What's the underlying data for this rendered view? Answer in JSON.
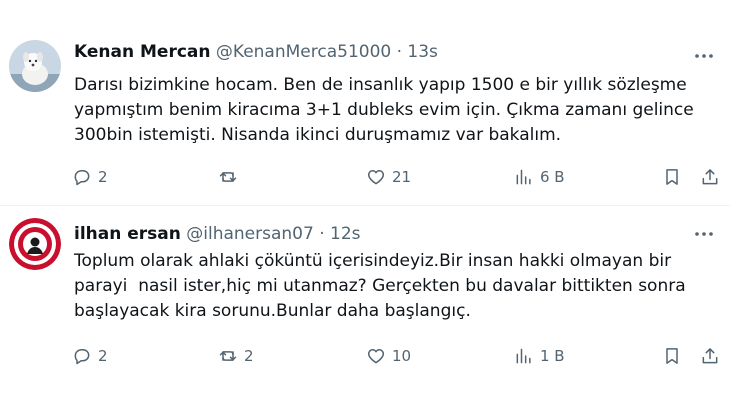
{
  "tweets": [
    {
      "name": "Kenan Mercan",
      "handle": "@KenanMerca51000",
      "separator": "·",
      "time": "13s",
      "avatar": "dog-photo-avatar",
      "lines": [
        "Darısı bizimkine hocam. Ben de insanlık yapıp 1500 e bir yıllık sözleşme",
        "yapmıştım benim kiracıma 3+1 dubleks evim için. Çıkma zamanı gelince",
        "300bin istemişti. Nisanda ikinci duruşmamız var bakalım."
      ],
      "replies": "2",
      "reposts": "",
      "likes": "21",
      "views": "6 B"
    },
    {
      "name": "ilhan ersan",
      "handle": "@ilhanersan07",
      "separator": "·",
      "time": "12s",
      "avatar": "club-emblem-avatar",
      "lines": [
        "Toplum olarak ahlaki çöküntü içerisindeyiz.Bir insan hakki olmayan bir",
        "parayi  nasil ister,hiç mi utanmaz? Gerçekten bu davalar bittikten sonra",
        "başlayacak kira sorunu.Bunlar daha başlangıç."
      ],
      "replies": "2",
      "reposts": "2",
      "likes": "10",
      "views": "1 B"
    }
  ],
  "icons": {
    "reply": "reply-icon",
    "repost": "repost-icon",
    "like": "heart-icon",
    "views": "views-icon",
    "bookmark": "bookmark-icon",
    "share": "share-icon",
    "more": "more-options-icon"
  },
  "colors": {
    "text": "#0f1419",
    "secondary": "#536471",
    "divider": "#eff3f4"
  }
}
